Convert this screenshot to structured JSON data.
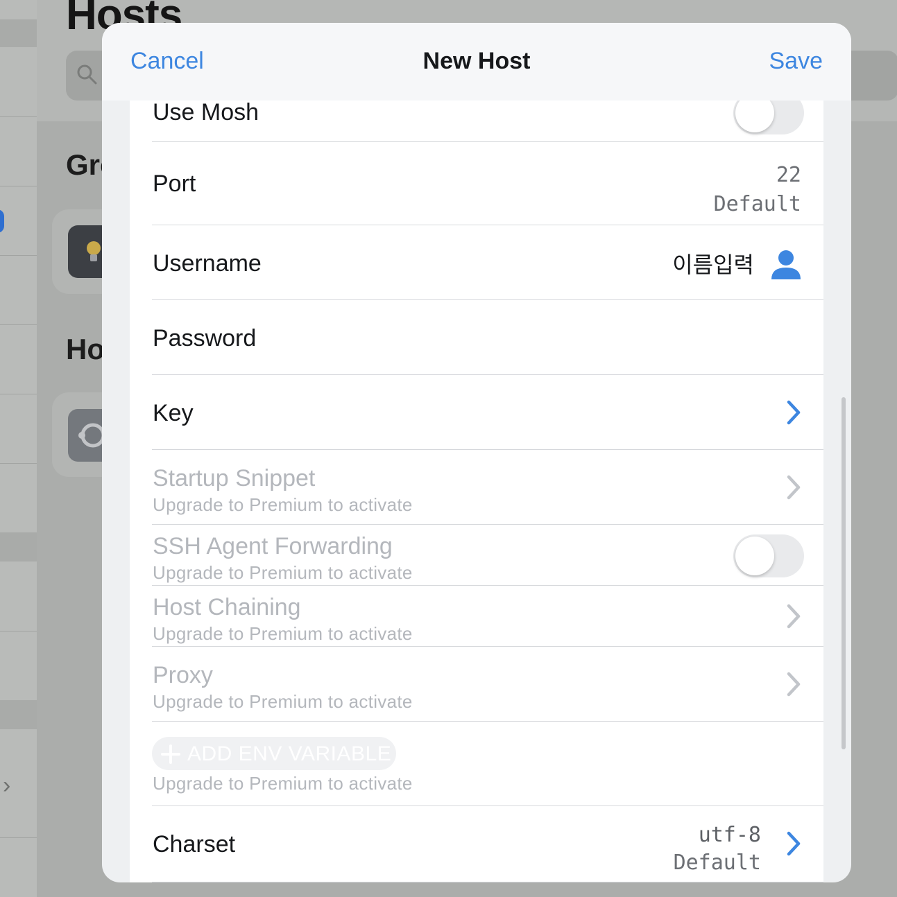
{
  "background": {
    "title": "Hosts",
    "groups_heading": "Groups",
    "hosts_heading": "Hosts"
  },
  "modal": {
    "cancel_label": "Cancel",
    "title": "New Host",
    "save_label": "Save"
  },
  "form": {
    "use_mosh": {
      "label": "Use Mosh",
      "enabled": false
    },
    "port": {
      "label": "Port",
      "value": "22",
      "hint": "Default"
    },
    "username": {
      "label": "Username",
      "value": "이름입력",
      "icon": "person-icon"
    },
    "password": {
      "label": "Password",
      "value": ""
    },
    "key": {
      "label": "Key",
      "icon": "chevron-right-icon"
    },
    "startup_snippet": {
      "label": "Startup Snippet",
      "sub": "Upgrade to Premium to activate"
    },
    "ssh_agent_forwarding": {
      "label": "SSH Agent Forwarding",
      "sub": "Upgrade to Premium to activate",
      "enabled": false
    },
    "host_chaining": {
      "label": "Host Chaining",
      "sub": "Upgrade to Premium to activate"
    },
    "proxy": {
      "label": "Proxy",
      "sub": "Upgrade to Premium to activate"
    },
    "env_variable": {
      "button_label": "ADD ENV VARIABLE",
      "sub": "Upgrade to Premium to activate"
    },
    "charset": {
      "label": "Charset",
      "value": "utf-8",
      "hint": "Default"
    }
  },
  "colors": {
    "accent": "#3d86e0",
    "disabled_text": "#b4b7bc",
    "primary_text": "#16181b"
  }
}
